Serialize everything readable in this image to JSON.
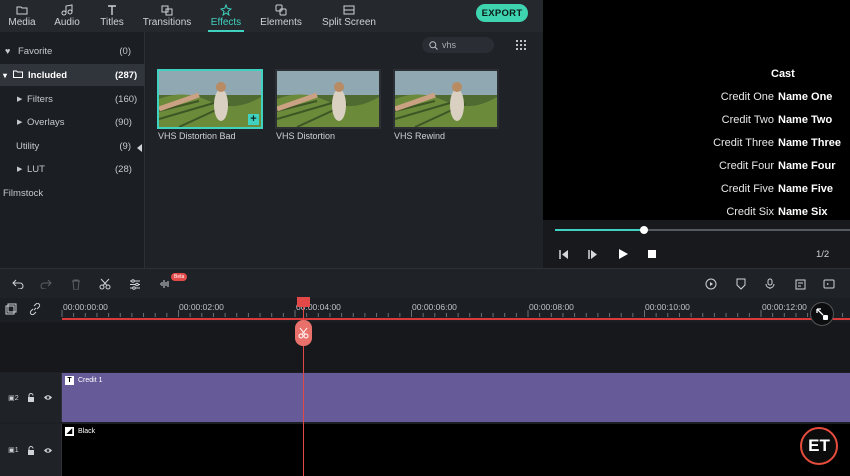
{
  "topbar": {
    "tabs": [
      {
        "label": "Media",
        "icon": "folder-icon"
      },
      {
        "label": "Audio",
        "icon": "music-note-icon"
      },
      {
        "label": "Titles",
        "icon": "text-t-icon"
      },
      {
        "label": "Transitions",
        "icon": "transitions-icon"
      },
      {
        "label": "Effects",
        "icon": "effects-sparkle-icon",
        "active": true
      },
      {
        "label": "Elements",
        "icon": "elements-icon"
      },
      {
        "label": "Split Screen",
        "icon": "split-screen-icon"
      }
    ],
    "export_label": "EXPORT"
  },
  "sidebar": {
    "items": [
      {
        "label": "Favorite",
        "count": "(0)",
        "icon": "heart-icon"
      },
      {
        "label": "Included",
        "count": "(287)",
        "icon": "folder-icon",
        "selected": true
      },
      {
        "label": "Filters",
        "count": "(160)"
      },
      {
        "label": "Overlays",
        "count": "(90)"
      },
      {
        "label": "Utility",
        "count": "(9)"
      },
      {
        "label": "LUT",
        "count": "(28)"
      },
      {
        "label": "Filmstock",
        "count": ""
      }
    ]
  },
  "browser": {
    "search_value": "vhs",
    "thumbnails": [
      {
        "label": "VHS Distortion Bad",
        "selected": true
      },
      {
        "label": "VHS Distortion"
      },
      {
        "label": "VHS Rewind"
      }
    ]
  },
  "preview": {
    "title": "Cast",
    "credits": [
      {
        "role": "Credit One",
        "first": "Name",
        "last": "One"
      },
      {
        "role": "Credit Two",
        "first": "Name",
        "last": "Two"
      },
      {
        "role": "Credit Three",
        "first": "Name",
        "last": "Three"
      },
      {
        "role": "Credit Four",
        "first": "Name",
        "last": "Four"
      },
      {
        "role": "Credit Five",
        "first": "Name",
        "last": "Five"
      },
      {
        "role": "Credit Six",
        "first": "Name",
        "last": "Six"
      }
    ],
    "progress_fraction": 0.3,
    "page_indicator": "1/2"
  },
  "timeline": {
    "beta_badge": "Beta",
    "ruler_labels": [
      "00:00:00:00",
      "00:00:02:00",
      "00:00:04:00",
      "00:00:06:00",
      "00:00:08:00",
      "00:00:10:00",
      "00:00:12:00"
    ],
    "tracks": [
      {
        "number": "2",
        "clip_label": "Credit 1",
        "clip_icon": "T"
      },
      {
        "number": "1",
        "clip_label": "Black",
        "clip_icon": "image-icon"
      }
    ]
  },
  "watermark": {
    "text": "ET"
  },
  "colors": {
    "accent": "#40d2c0",
    "export": "#3fd4b0",
    "playhead": "#e24848",
    "title_clip": "#675a99",
    "background": "#1c1f24"
  }
}
